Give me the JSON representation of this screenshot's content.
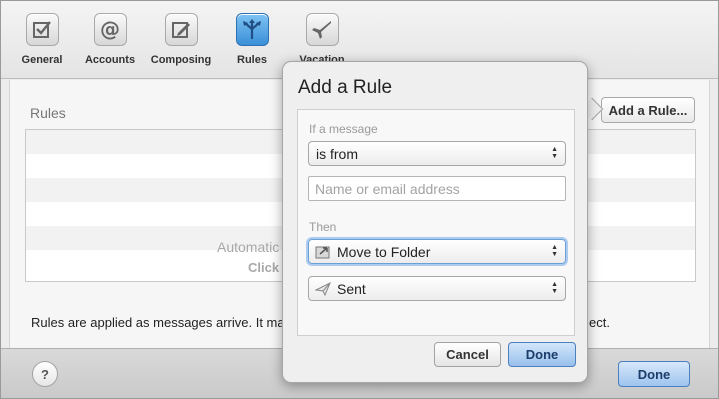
{
  "toolbar": {
    "items": [
      {
        "label": "General",
        "icon": "general-checkbox-icon"
      },
      {
        "label": "Accounts",
        "icon": "at-sign-icon"
      },
      {
        "label": "Composing",
        "icon": "compose-icon"
      },
      {
        "label": "Rules",
        "icon": "rules-arrows-icon",
        "selected": true
      },
      {
        "label": "Vacation",
        "icon": "airplane-icon"
      }
    ]
  },
  "rules": {
    "title": "Rules",
    "empty_line1": "Automatic",
    "empty_line2": "Click",
    "add_rule_label": "Add a Rule...",
    "footnote_left": "Rules are applied as messages arrive. It ma",
    "footnote_right": "ect."
  },
  "footer": {
    "help_label": "?",
    "done_label": "Done"
  },
  "popover": {
    "title": "Add a Rule",
    "condition_label": "If a message",
    "condition_value": "is from",
    "address_placeholder": "Name or email address",
    "then_label": "Then",
    "action_value": "Move to Folder",
    "folder_value": "Sent",
    "cancel_label": "Cancel",
    "done_label": "Done"
  },
  "colors": {
    "accent": "#3a8fd8",
    "done_button": "#98c0ec"
  }
}
